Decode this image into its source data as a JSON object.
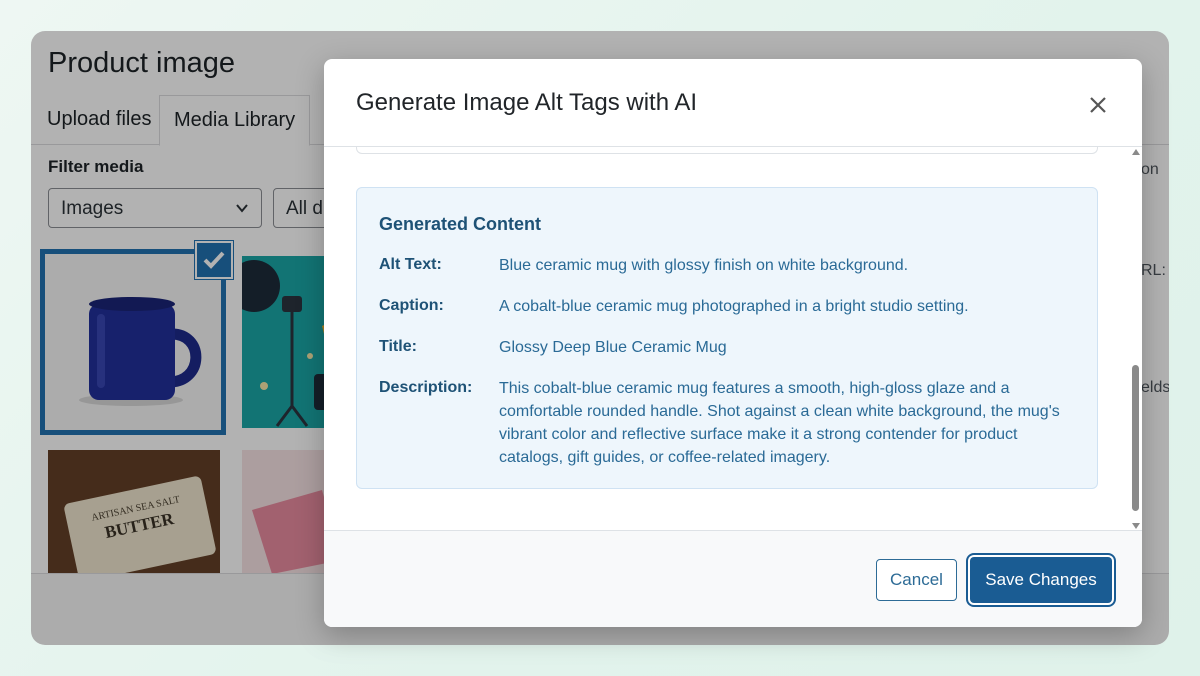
{
  "background": {
    "title": "Product image",
    "tabs": [
      "Upload files",
      "Media Library"
    ],
    "filter_label": "Filter media",
    "filter_type": "Images",
    "filter_date": "All d",
    "side_labels": [
      "on",
      "RL:",
      "elds"
    ],
    "thumbnails": [
      "blue-mug",
      "studio-illustration",
      "butter-soap",
      "pink-paper"
    ],
    "selected_thumbnail": "blue-mug",
    "butter_label": {
      "line1": "ARTISAN SEA SALT",
      "line2": "BUTTER"
    }
  },
  "modal": {
    "title": "Generate Image Alt Tags with AI",
    "close_icon": "close-icon",
    "generated": {
      "heading": "Generated Content",
      "rows": [
        {
          "label": "Alt Text:",
          "value": "Blue ceramic mug with glossy finish on white background."
        },
        {
          "label": "Caption:",
          "value": "A cobalt-blue ceramic mug photographed in a bright studio setting."
        },
        {
          "label": "Title:",
          "value": "Glossy Deep Blue Ceramic Mug"
        },
        {
          "label": "Description:",
          "value": "This cobalt-blue ceramic mug features a smooth, high-gloss glaze and a comfortable rounded handle. Shot against a clean white background, the mug's vibrant color and reflective surface make it a strong contender for product catalogs, gift guides, or coffee-related imagery."
        }
      ]
    },
    "footer": {
      "cancel_label": "Cancel",
      "save_label": "Save Changes"
    }
  },
  "colors": {
    "primary": "#1a5c93",
    "accent": "#2271b1",
    "panel_bg": "#eef6fc",
    "panel_text": "#1e5276"
  }
}
